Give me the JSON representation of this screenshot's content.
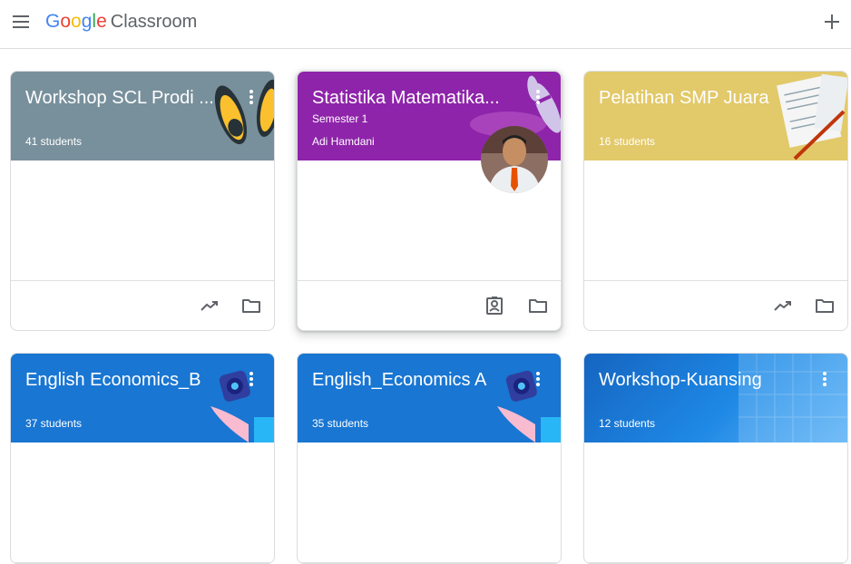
{
  "topbar": {
    "menu_icon": "hamburger-icon",
    "logo_letters": [
      "G",
      "o",
      "o",
      "g",
      "l",
      "e"
    ],
    "logo_colors": [
      "#4285F4",
      "#EA4335",
      "#FBBC05",
      "#4285F4",
      "#34A853",
      "#EA4335"
    ],
    "product_name": "Classroom",
    "add_icon": "plus-icon"
  },
  "classes": [
    {
      "title": "Workshop SCL Prodi ...",
      "students": "41 students",
      "color": "#78909c"
    },
    {
      "title": "Statistika Matematika...",
      "section": "Semester 1",
      "teacher": "Adi Hamdani",
      "color": "#8e24aa"
    },
    {
      "title": "Pelatihan SMP Juara",
      "students": "16 students",
      "color": "#e2c96a"
    },
    {
      "title": "English Economics_B",
      "students": "37 students",
      "color": "#1976d2"
    },
    {
      "title": "English_Economics A",
      "students": "35 students",
      "color": "#1976d2"
    },
    {
      "title": "Workshop-Kuansing",
      "students": "12 students",
      "color": "#1e6fc9"
    }
  ],
  "icons": {
    "card_menu": "more-vert-icon",
    "insights": "trending-up-icon",
    "folder": "folder-icon",
    "work": "assigned-work-icon"
  }
}
